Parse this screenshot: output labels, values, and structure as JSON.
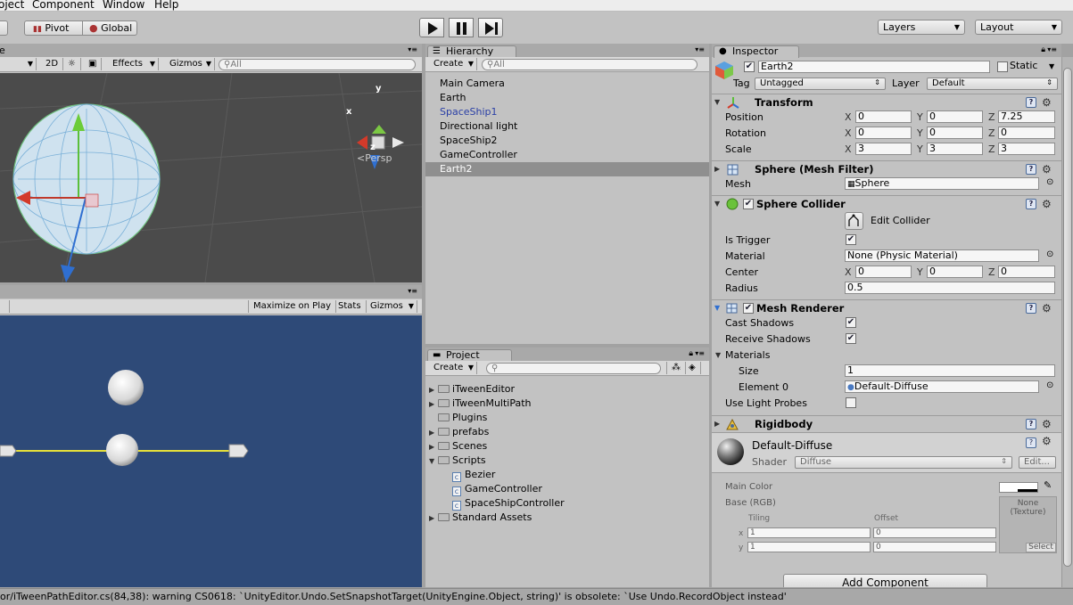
{
  "menu": {
    "project_partial": "oject",
    "component": "Component",
    "window": "Window",
    "help": "Help"
  },
  "toolbar": {
    "pivot": "Pivot",
    "global": "Global",
    "layers": "Layers",
    "layout": "Layout"
  },
  "scene": {
    "mode_2d": "2D",
    "effects": "Effects",
    "gizmos": "Gizmos",
    "search_placeholder": "All",
    "persp": "Persp",
    "axis_x": "x",
    "axis_y": "y",
    "axis_z": "z",
    "tab_partial": "e"
  },
  "game": {
    "maximize": "Maximize on Play",
    "stats": "Stats",
    "gizmos": "Gizmos"
  },
  "hierarchy": {
    "title": "Hierarchy",
    "create": "Create",
    "search_placeholder": "All",
    "items": [
      "Main Camera",
      "Earth",
      "SpaceShip1",
      "Directional light",
      "SpaceShip2",
      "GameController",
      "Earth2"
    ],
    "selected_index": 6,
    "prefab_index": 2
  },
  "project": {
    "title": "Project",
    "create": "Create",
    "items": [
      {
        "name": "iTweenEditor",
        "type": "folder",
        "level": 0,
        "expandable": true
      },
      {
        "name": "iTweenMultiPath",
        "type": "folder",
        "level": 0,
        "expandable": true
      },
      {
        "name": "Plugins",
        "type": "folder",
        "level": 0,
        "expandable": false
      },
      {
        "name": "prefabs",
        "type": "folder",
        "level": 0,
        "expandable": true
      },
      {
        "name": "Scenes",
        "type": "folder",
        "level": 0,
        "expandable": true
      },
      {
        "name": "Scripts",
        "type": "folder",
        "level": 0,
        "expandable": true,
        "expanded": true
      },
      {
        "name": "Bezier",
        "type": "script",
        "level": 1
      },
      {
        "name": "GameController",
        "type": "script",
        "level": 1
      },
      {
        "name": "SpaceShipController",
        "type": "script",
        "level": 1
      },
      {
        "name": "Standard Assets",
        "type": "folder",
        "level": 0,
        "expandable": true
      }
    ]
  },
  "inspector": {
    "title": "Inspector",
    "object_name": "Earth2",
    "static_label": "Static",
    "tag_label": "Tag",
    "tag_value": "Untagged",
    "layer_label": "Layer",
    "layer_value": "Default",
    "transform": {
      "title": "Transform",
      "position_label": "Position",
      "rotation_label": "Rotation",
      "scale_label": "Scale",
      "position": {
        "x": "0",
        "y": "0",
        "z": "7.25"
      },
      "rotation": {
        "x": "0",
        "y": "0",
        "z": "0"
      },
      "scale": {
        "x": "3",
        "y": "3",
        "z": "3"
      }
    },
    "mesh_filter": {
      "title": "Sphere (Mesh Filter)",
      "mesh_label": "Mesh",
      "mesh_value": "Sphere"
    },
    "collider": {
      "title": "Sphere Collider",
      "edit": "Edit Collider",
      "is_trigger_label": "Is Trigger",
      "material_label": "Material",
      "material_value": "None (Physic Material)",
      "center_label": "Center",
      "center": {
        "x": "0",
        "y": "0",
        "z": "0"
      },
      "radius_label": "Radius",
      "radius": "0.5"
    },
    "renderer": {
      "title": "Mesh Renderer",
      "cast_label": "Cast Shadows",
      "receive_label": "Receive Shadows",
      "materials_label": "Materials",
      "size_label": "Size",
      "size": "1",
      "element_label": "Element 0",
      "element_value": "Default-Diffuse",
      "probes_label": "Use Light Probes"
    },
    "rigidbody": {
      "title": "Rigidbody"
    },
    "material": {
      "name": "Default-Diffuse",
      "shader_label": "Shader",
      "shader_value": "Diffuse",
      "edit": "Edit...",
      "main_color_label": "Main Color",
      "base_label": "Base (RGB)",
      "tiling_label": "Tiling",
      "offset_label": "Offset",
      "tiling": {
        "x": "1",
        "y": "1"
      },
      "offset": {
        "x": "0",
        "y": "0"
      },
      "texture_none": "None",
      "texture_type": "(Texture)",
      "select": "Select"
    },
    "add_component": "Add Component"
  },
  "status": {
    "message": "or/iTweenPathEditor.cs(84,38): warning CS0618: `UnityEditor.Undo.SetSnapshotTarget(UnityEngine.Object, string)' is obsolete: `Use Undo.RecordObject instead'"
  },
  "colors": {
    "panel": "#c2c2c2",
    "scene_bg": "#4b4b4b",
    "game_bg": "#2e4a78",
    "selected_row": "#8f8f8f",
    "prefab_text": "#2a3fa6"
  }
}
